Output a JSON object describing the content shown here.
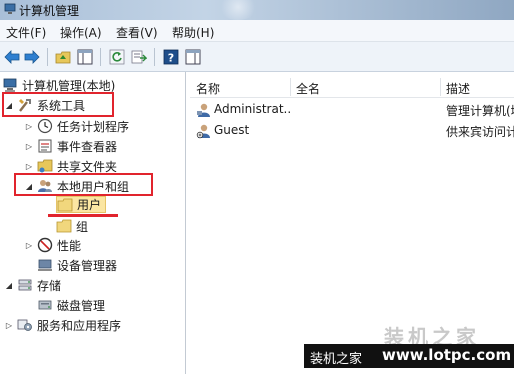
{
  "window": {
    "title": "计算机管理"
  },
  "menu": [
    "文件(F)",
    "操作(A)",
    "查看(V)",
    "帮助(H)"
  ],
  "toolbar": {
    "buttons": [
      "back-icon",
      "forward-icon",
      "up-folder-icon",
      "show-hide-tree-icon",
      "refresh-icon",
      "export-list-icon",
      "help-icon",
      "action-pane-icon"
    ]
  },
  "tree": {
    "root": "计算机管理(本地)",
    "system_tools": "系统工具",
    "task_scheduler": "任务计划程序",
    "event_viewer": "事件查看器",
    "shared_folders": "共享文件夹",
    "local_users_groups": "本地用户和组",
    "users": "用户",
    "groups": "组",
    "performance": "性能",
    "device_manager": "设备管理器",
    "storage": "存储",
    "disk_management": "磁盘管理",
    "services_apps": "服务和应用程序"
  },
  "list": {
    "headers": [
      "名称",
      "全名",
      "描述"
    ],
    "rows": [
      {
        "name": "Administrat...",
        "fullname": "",
        "desc": "管理计算机(域"
      },
      {
        "name": "Guest",
        "fullname": "",
        "desc": "供来宾访问计"
      }
    ]
  },
  "watermark": {
    "big": "装机之家",
    "small": "装机之家",
    "url": "www.lotpc.com"
  },
  "colors": {
    "highlight": "#e1242d",
    "selection": "#fbe6a2"
  }
}
